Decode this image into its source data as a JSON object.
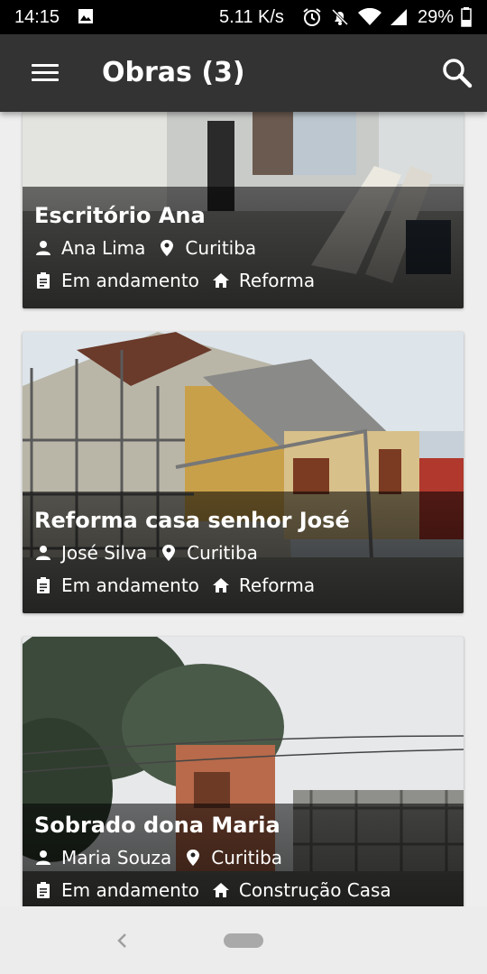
{
  "status_bar": {
    "time": "14:15",
    "speed": "5.11 K/s",
    "battery": "29%"
  },
  "app_bar": {
    "title": "Obras (3)"
  },
  "cards": [
    {
      "title": "Escritório Ana",
      "owner": "Ana Lima",
      "city": "Curitiba",
      "status": "Em andamento",
      "type": "Reforma"
    },
    {
      "title": "Reforma casa senhor José",
      "owner": "José Silva",
      "city": "Curitiba",
      "status": "Em andamento",
      "type": "Reforma"
    },
    {
      "title": "Sobrado dona Maria",
      "owner": "Maria Souza",
      "city": "Curitiba",
      "status": "Em andamento",
      "type": "Construção Casa"
    }
  ],
  "icons": {
    "menu": "menu-icon",
    "search": "search-icon",
    "person": "person-icon",
    "location": "location-pin-icon",
    "clipboard": "clipboard-icon",
    "home": "home-icon",
    "back": "back-icon",
    "home_pill": "home-pill"
  },
  "colors": {
    "app_bar": "#333333",
    "background": "#eeeeee",
    "text": "#ffffff"
  }
}
